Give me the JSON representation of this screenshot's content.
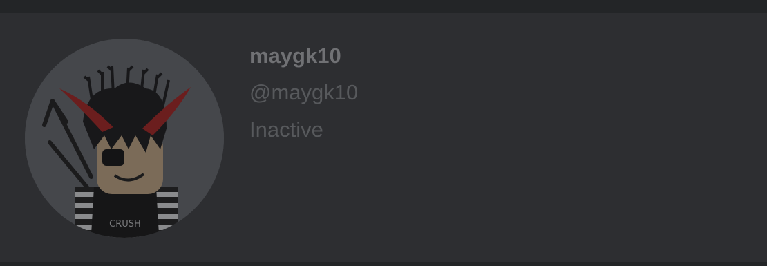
{
  "profile": {
    "display_name": "maygk10",
    "username": "@maygk10",
    "status": "Inactive",
    "avatar_shirt_text": "CRUSH"
  },
  "colors": {
    "background": "#2d2e31",
    "top_bar": "#232527",
    "avatar_circle": "#45474b",
    "name_text": "#707174",
    "secondary_text": "#57595c",
    "horn": "#6b1e1e"
  },
  "icons": {
    "avatar": "roblox-avatar-image"
  }
}
